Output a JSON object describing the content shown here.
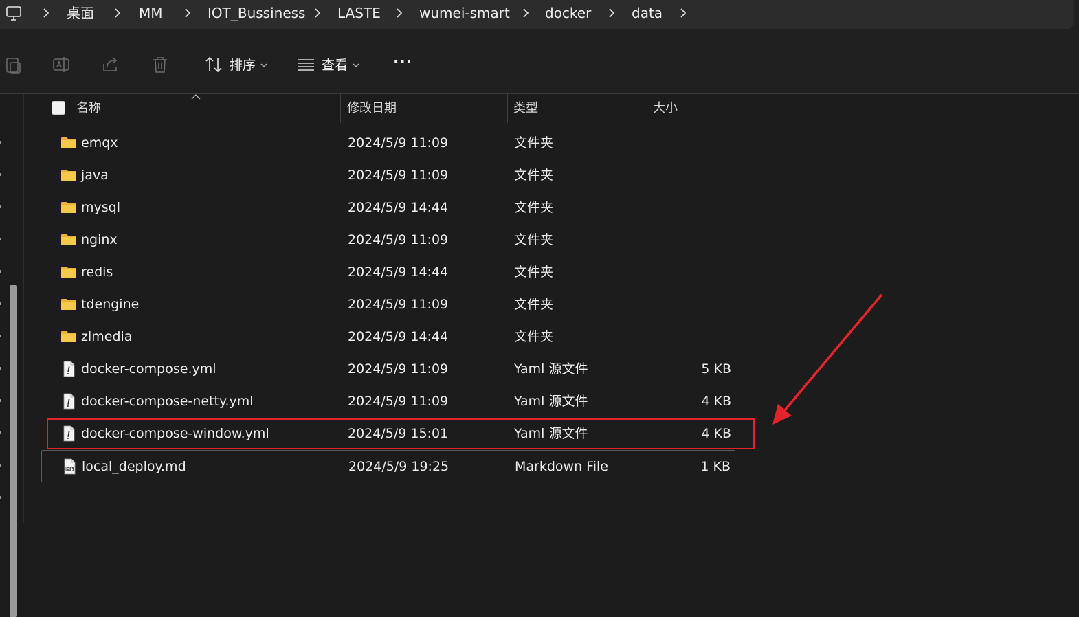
{
  "breadcrumb": {
    "items": [
      "桌面",
      "MM",
      "IOT_Bussiness",
      "LASTE",
      "wumei-smart",
      "docker",
      "data"
    ]
  },
  "toolbar": {
    "sort_label": "排序",
    "view_label": "查看",
    "more_label": "···"
  },
  "columns": {
    "name": "名称",
    "date": "修改日期",
    "type": "类型",
    "size": "大小"
  },
  "files": [
    {
      "name": "emqx",
      "date": "2024/5/9 11:09",
      "type": "文件夹",
      "size": "",
      "icon": "folder-icon"
    },
    {
      "name": "java",
      "date": "2024/5/9 11:09",
      "type": "文件夹",
      "size": "",
      "icon": "folder-icon"
    },
    {
      "name": "mysql",
      "date": "2024/5/9 14:44",
      "type": "文件夹",
      "size": "",
      "icon": "folder-icon"
    },
    {
      "name": "nginx",
      "date": "2024/5/9 11:09",
      "type": "文件夹",
      "size": "",
      "icon": "folder-icon"
    },
    {
      "name": "redis",
      "date": "2024/5/9 14:44",
      "type": "文件夹",
      "size": "",
      "icon": "folder-icon"
    },
    {
      "name": "tdengine",
      "date": "2024/5/9 11:09",
      "type": "文件夹",
      "size": "",
      "icon": "folder-icon"
    },
    {
      "name": "zlmedia",
      "date": "2024/5/9 14:44",
      "type": "文件夹",
      "size": "",
      "icon": "folder-icon"
    },
    {
      "name": "docker-compose.yml",
      "date": "2024/5/9 11:09",
      "type": "Yaml 源文件",
      "size": "5 KB",
      "icon": "yaml-file-icon"
    },
    {
      "name": "docker-compose-netty.yml",
      "date": "2024/5/9 11:09",
      "type": "Yaml 源文件",
      "size": "4 KB",
      "icon": "yaml-file-icon"
    },
    {
      "name": "docker-compose-window.yml",
      "date": "2024/5/9 15:01",
      "type": "Yaml 源文件",
      "size": "4 KB",
      "icon": "yaml-file-icon"
    },
    {
      "name": "local_deploy.md",
      "date": "2024/5/9 19:25",
      "type": "Markdown File",
      "size": "1 KB",
      "icon": "markdown-file-icon"
    }
  ],
  "colors": {
    "annotation": "#e3252b",
    "folder": "#f5c94a"
  }
}
